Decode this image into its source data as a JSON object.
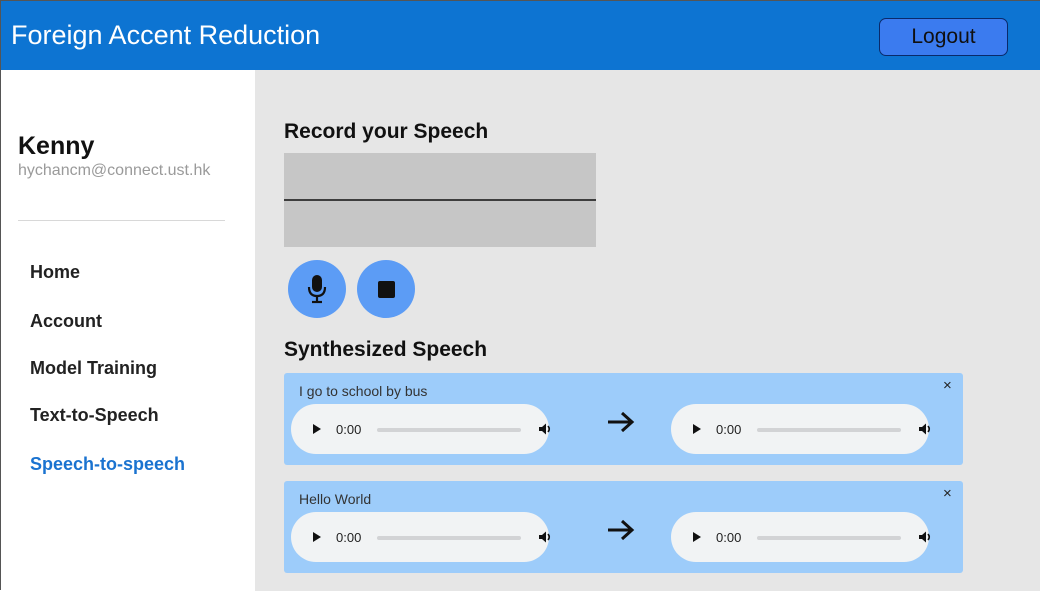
{
  "header": {
    "title": "Foreign Accent Reduction",
    "logout_label": "Logout"
  },
  "user": {
    "name": "Kenny",
    "email": "hychancm@connect.ust.hk"
  },
  "nav": [
    {
      "label": "Home",
      "active": false
    },
    {
      "label": "Account",
      "active": false
    },
    {
      "label": "Model Training",
      "active": false
    },
    {
      "label": "Text-to-Speech",
      "active": false
    },
    {
      "label": "Speech-to-speech",
      "active": true
    }
  ],
  "record": {
    "title": "Record your Speech",
    "mic_icon": "microphone-icon",
    "stop_icon": "stop-icon"
  },
  "synth": {
    "title": "Synthesized Speech",
    "cards": [
      {
        "text": "I go to school by bus",
        "close": "×",
        "input_time": "0:00",
        "output_time": "0:00"
      },
      {
        "text": "Hello World",
        "close": "×",
        "input_time": "0:00",
        "output_time": "0:00"
      }
    ]
  },
  "colors": {
    "header": "#0d74d2",
    "active_nav": "#1a73d0",
    "button": "#5c9cf5",
    "card": "#9dccfa",
    "main_bg": "#e6e6e6"
  }
}
